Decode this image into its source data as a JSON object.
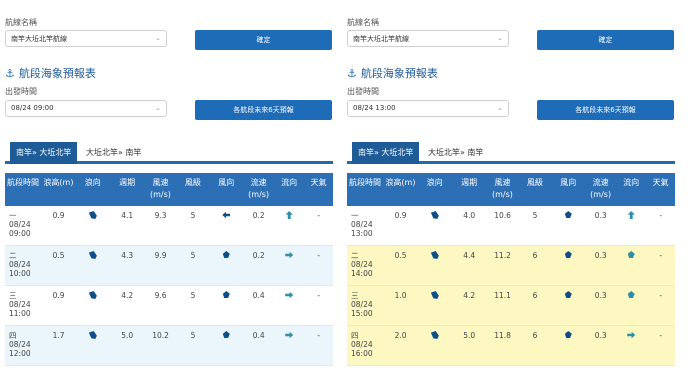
{
  "left": {
    "route_label": "航線名稱",
    "route_value": "南竿大坵北竿航線",
    "confirm_label": "確定",
    "forecast_title": "航段海象預報表",
    "depart_label": "出發時間",
    "depart_value": "08/24 09:00",
    "six_day_label": "各航段未來6天預報",
    "tabs": [
      "南竿» 大坵北竿",
      "大坵北竿» 南竿"
    ],
    "headers": [
      "航段時間",
      "浪高(m)",
      "浪向",
      "週期",
      "風速(m/s)",
      "風級",
      "風向",
      "流速(m/s)",
      "流向",
      "天氣"
    ],
    "rows": [
      {
        "seg": "一",
        "date": "08/24",
        "time": "09:00",
        "wave_h": "0.9",
        "period": "4.1",
        "wind_s": "9.3",
        "wind_lv": "5",
        "cur_s": "0.2",
        "weather": "-"
      },
      {
        "seg": "二",
        "date": "08/24",
        "time": "10:00",
        "wave_h": "0.5",
        "period": "4.3",
        "wind_s": "9.9",
        "wind_lv": "5",
        "cur_s": "0.2",
        "weather": "-"
      },
      {
        "seg": "三",
        "date": "08/24",
        "time": "11:00",
        "wave_h": "0.9",
        "period": "4.2",
        "wind_s": "9.6",
        "wind_lv": "5",
        "cur_s": "0.4",
        "weather": "-"
      },
      {
        "seg": "四",
        "date": "08/24",
        "time": "12:00",
        "wave_h": "1.7",
        "period": "5.0",
        "wind_s": "10.2",
        "wind_lv": "5",
        "cur_s": "0.4",
        "weather": "-"
      }
    ]
  },
  "right": {
    "route_label": "航線名稱",
    "route_value": "南竿大坵北竿航線",
    "confirm_label": "確定",
    "forecast_title": "航段海象預報表",
    "depart_label": "出發時間",
    "depart_value": "08/24 13:00",
    "six_day_label": "各航段未來6天預報",
    "tabs": [
      "南竿» 大坵北竿",
      "大坵北竿» 南竿"
    ],
    "headers": [
      "航段時間",
      "浪高(m)",
      "浪向",
      "週期",
      "風速(m/s)",
      "風級",
      "風向",
      "流速(m/s)",
      "流向",
      "天氣"
    ],
    "rows": [
      {
        "seg": "一",
        "date": "08/24",
        "time": "13:00",
        "wave_h": "0.9",
        "period": "4.0",
        "wind_s": "10.6",
        "wind_lv": "5",
        "cur_s": "0.3",
        "weather": "-"
      },
      {
        "seg": "二",
        "date": "08/24",
        "time": "14:00",
        "wave_h": "0.5",
        "period": "4.4",
        "wind_s": "11.2",
        "wind_lv": "6",
        "cur_s": "0.3",
        "weather": "-"
      },
      {
        "seg": "三",
        "date": "08/24",
        "time": "15:00",
        "wave_h": "1.0",
        "period": "4.2",
        "wind_s": "11.1",
        "wind_lv": "6",
        "cur_s": "0.3",
        "weather": "-"
      },
      {
        "seg": "四",
        "date": "08/24",
        "time": "16:00",
        "wave_h": "2.0",
        "period": "5.0",
        "wind_s": "11.8",
        "wind_lv": "6",
        "cur_s": "0.3",
        "weather": "-"
      }
    ]
  },
  "colors": {
    "header_blue": "#2d6fb5",
    "button_blue": "#1e6bb8",
    "row_alt_left": "#eaf6fb",
    "row_alt_right": "#fdf7c2"
  },
  "icons": [
    "anchor-icon",
    "wave-direction-icon",
    "wind-direction-icon",
    "current-direction-icon",
    "chevron-down-icon"
  ]
}
